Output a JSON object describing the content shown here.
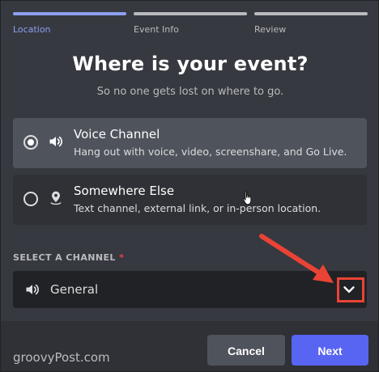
{
  "steps": [
    {
      "label": "Location",
      "active": true
    },
    {
      "label": "Event Info",
      "active": false
    },
    {
      "label": "Review",
      "active": false
    }
  ],
  "title": "Where is your event?",
  "subtitle": "So no one gets lost on where to go.",
  "options": [
    {
      "title": "Voice Channel",
      "description": "Hang out with voice, video, screenshare, and Go Live.",
      "selected": true,
      "icon": "speaker-icon"
    },
    {
      "title": "Somewhere Else",
      "description": "Text channel, external link, or in-person location.",
      "selected": false,
      "icon": "location-pin-icon"
    }
  ],
  "channel_select": {
    "label": "SELECT A CHANNEL",
    "required_mark": "*",
    "value": "General",
    "icon": "speaker-icon"
  },
  "buttons": {
    "cancel": "Cancel",
    "next": "Next"
  },
  "watermark": "groovyPost.com",
  "colors": {
    "accent": "#5865f2",
    "step_active": "#8da0f0",
    "annotation_red": "#ea4335"
  }
}
